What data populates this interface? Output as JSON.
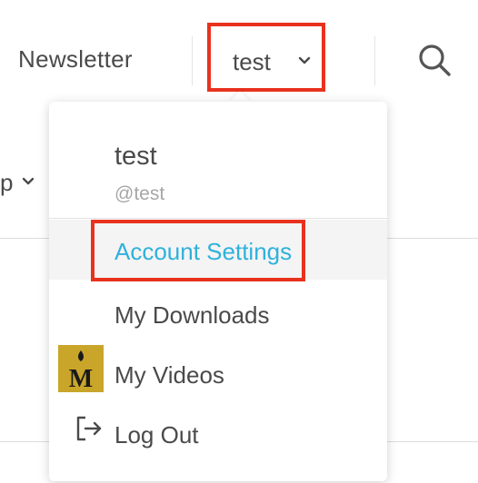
{
  "nav": {
    "newsletter_label": "Newsletter",
    "user_label": "test",
    "search_icon": "search-icon",
    "chevron_icon": "chevron-down-icon"
  },
  "background": {
    "fragment_text": "p"
  },
  "dropdown": {
    "user_name": "test",
    "user_handle": "@test",
    "items": [
      {
        "label": "Account Settings",
        "icon": "",
        "highlighted": true
      },
      {
        "label": "My Downloads",
        "icon": ""
      },
      {
        "label": "My Videos",
        "icon": "m-logo"
      },
      {
        "label": "Log Out",
        "icon": "logout-icon"
      }
    ],
    "logo_letter": "M"
  },
  "colors": {
    "highlight_border": "#e8321e",
    "link_blue": "#2fb1dc",
    "logo_gold": "#c9a52a"
  }
}
